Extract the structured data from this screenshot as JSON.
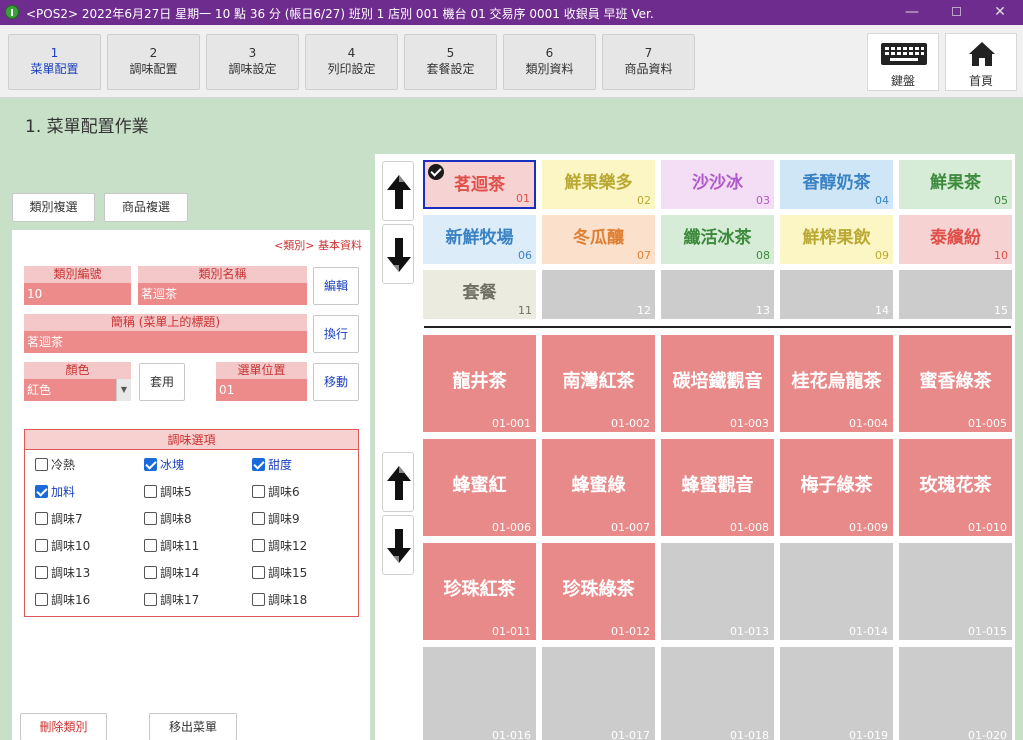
{
  "window": {
    "title": "<POS2> 2022年6月27日 星期一 10 點 36 分 (帳日6/27) 班別 1 店別 001 機台 01 交易序 0001 收銀員 早班 Ver."
  },
  "tabs": [
    {
      "num": "1",
      "label": "菜單配置"
    },
    {
      "num": "2",
      "label": "調味配置"
    },
    {
      "num": "3",
      "label": "調味設定"
    },
    {
      "num": "4",
      "label": "列印設定"
    },
    {
      "num": "5",
      "label": "套餐設定"
    },
    {
      "num": "6",
      "label": "類別資料"
    },
    {
      "num": "7",
      "label": "商品資料"
    }
  ],
  "toolbar": {
    "keyboard_label": "鍵盤",
    "home_label": "首頁"
  },
  "page": {
    "title": "1. 菜單配置作業"
  },
  "left": {
    "copy_category_label": "類別複選",
    "copy_product_label": "商品複選",
    "breadcrumb": "<類別> 基本資料",
    "category_code_label": "類別編號",
    "category_code_value": "10",
    "category_name_label": "類別名稱",
    "category_name_value": "茗迴茶",
    "edit_label": "編輯",
    "short_name_label": "簡稱 (菜單上的標題)",
    "short_name_value": "茗迴茶",
    "wrap_label": "換行",
    "color_label": "顏色",
    "color_value": "紅色",
    "apply_label": "套用",
    "menu_position_label": "選單位置",
    "menu_position_value": "01",
    "move_label": "移動",
    "seasoning_title": "調味選項",
    "seasonings": [
      {
        "label": "冷熱",
        "checked": false
      },
      {
        "label": "冰塊",
        "checked": true
      },
      {
        "label": "甜度",
        "checked": true
      },
      {
        "label": "加料",
        "checked": true
      },
      {
        "label": "調味5",
        "checked": false
      },
      {
        "label": "調味6",
        "checked": false
      },
      {
        "label": "調味7",
        "checked": false
      },
      {
        "label": "調味8",
        "checked": false
      },
      {
        "label": "調味9",
        "checked": false
      },
      {
        "label": "調味10",
        "checked": false
      },
      {
        "label": "調味11",
        "checked": false
      },
      {
        "label": "調味12",
        "checked": false
      },
      {
        "label": "調味13",
        "checked": false
      },
      {
        "label": "調味14",
        "checked": false
      },
      {
        "label": "調味15",
        "checked": false
      },
      {
        "label": "調味16",
        "checked": false
      },
      {
        "label": "調味17",
        "checked": false
      },
      {
        "label": "調味18",
        "checked": false
      }
    ],
    "delete_category_label": "刪除類別",
    "remove_menu_label": "移出菜單"
  },
  "categories": [
    {
      "name": "茗迴茶",
      "code": "01",
      "bg": "#f7d2d2",
      "fg": "#e0504a",
      "selected": true
    },
    {
      "name": "鮮果樂多",
      "code": "02",
      "bg": "#fbf6c3",
      "fg": "#b9a934"
    },
    {
      "name": "沙沙冰",
      "code": "03",
      "bg": "#f3def6",
      "fg": "#b059c8"
    },
    {
      "name": "香醇奶茶",
      "code": "04",
      "bg": "#cfe6f6",
      "fg": "#3a82c4"
    },
    {
      "name": "鮮果茶",
      "code": "05",
      "bg": "#d6ecd6",
      "fg": "#3c8a3c"
    },
    {
      "name": "新鮮牧場",
      "code": "06",
      "bg": "#dcecf8",
      "fg": "#3a82c4"
    },
    {
      "name": "冬瓜釀",
      "code": "07",
      "bg": "#fbe0cc",
      "fg": "#e08034"
    },
    {
      "name": "纖活冰茶",
      "code": "08",
      "bg": "#d6ecd6",
      "fg": "#3c8a3c"
    },
    {
      "name": "鮮榨果飲",
      "code": "09",
      "bg": "#fbf6c3",
      "fg": "#b9a934"
    },
    {
      "name": "泰繽紛",
      "code": "10",
      "bg": "#f7d2d2",
      "fg": "#e0504a"
    },
    {
      "name": "套餐",
      "code": "11",
      "bg": "#ecebe0",
      "fg": "#6f6f64"
    },
    {
      "name": "",
      "code": "12",
      "bg": "#cccccc",
      "fg": "#ffffff"
    },
    {
      "name": "",
      "code": "13",
      "bg": "#cccccc",
      "fg": "#ffffff"
    },
    {
      "name": "",
      "code": "14",
      "bg": "#cccccc",
      "fg": "#ffffff"
    },
    {
      "name": "",
      "code": "15",
      "bg": "#cccccc",
      "fg": "#ffffff"
    }
  ],
  "products": [
    {
      "name": "龍井茶",
      "code": "01-001"
    },
    {
      "name": "南灣紅茶",
      "code": "01-002"
    },
    {
      "name": "碳培鐵觀音",
      "code": "01-003"
    },
    {
      "name": "桂花烏龍茶",
      "code": "01-004"
    },
    {
      "name": "蜜香綠茶",
      "code": "01-005"
    },
    {
      "name": "蜂蜜紅",
      "code": "01-006"
    },
    {
      "name": "蜂蜜綠",
      "code": "01-007"
    },
    {
      "name": "蜂蜜觀音",
      "code": "01-008"
    },
    {
      "name": "梅子綠茶",
      "code": "01-009"
    },
    {
      "name": "玫瑰花茶",
      "code": "01-010"
    },
    {
      "name": "珍珠紅茶",
      "code": "01-011"
    },
    {
      "name": "珍珠綠茶",
      "code": "01-012"
    },
    {
      "name": "",
      "code": "01-013"
    },
    {
      "name": "",
      "code": "01-014"
    },
    {
      "name": "",
      "code": "01-015"
    },
    {
      "name": "",
      "code": "01-016"
    },
    {
      "name": "",
      "code": "01-017"
    },
    {
      "name": "",
      "code": "01-018"
    },
    {
      "name": "",
      "code": "01-019"
    },
    {
      "name": "",
      "code": "01-020"
    }
  ]
}
